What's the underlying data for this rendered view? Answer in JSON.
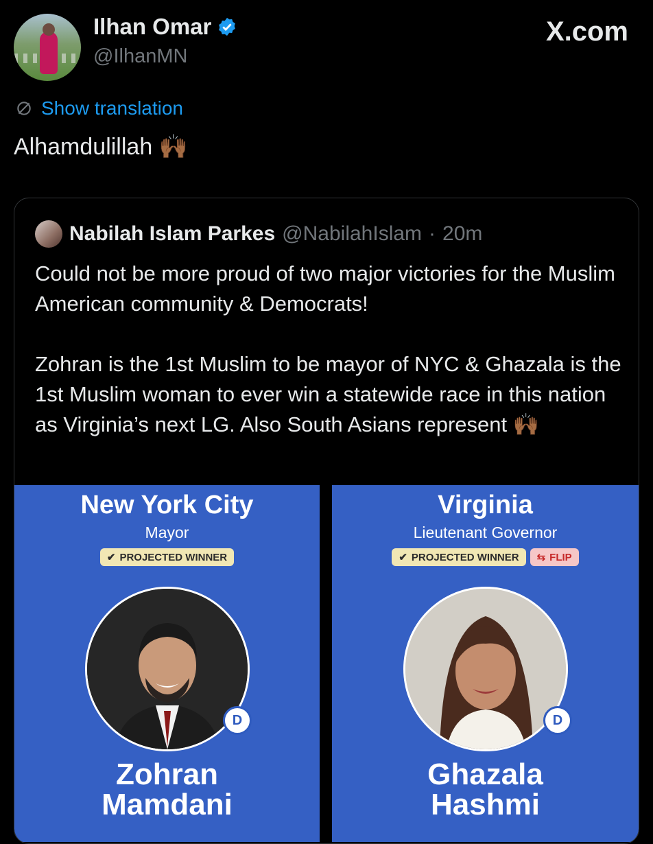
{
  "author": {
    "name": "Ilhan Omar",
    "handle": "@IlhanMN"
  },
  "site_label": "X.com",
  "show_translation": "Show translation",
  "tweet_text": "Alhamdulillah 🙌🏾",
  "quoted": {
    "name": "Nabilah Islam Parkes",
    "handle": "@NabilahIslam",
    "separator": "·",
    "time": "20m",
    "paragraph1": "Could not be more proud of two major victories for the Muslim American community & Democrats!",
    "paragraph2": "Zohran is the 1st Muslim to be mayor of NYC  & Ghazala is the 1st Muslim woman to ever win a statewide race in this nation as Virginia’s next LG. Also South Asians represent 🙌🏾"
  },
  "cards": [
    {
      "region": "New York City",
      "office": "Mayor",
      "badge": "PROJECTED WINNER",
      "party": "D",
      "first_name": "Zohran",
      "last_name": "Mamdani"
    },
    {
      "region": "Virginia",
      "office": "Lieutenant Governor",
      "badge": "PROJECTED WINNER",
      "flip_badge": "FLIP",
      "party": "D",
      "first_name": "Ghazala",
      "last_name": "Hashmi"
    }
  ],
  "colors": {
    "background": "#000000",
    "link": "#1d9bf0",
    "card_blue": "#3560c4",
    "verified": "#1d9bf0",
    "winner_badge": "#f1e7b4",
    "flip_badge": "#f6c7c7"
  }
}
